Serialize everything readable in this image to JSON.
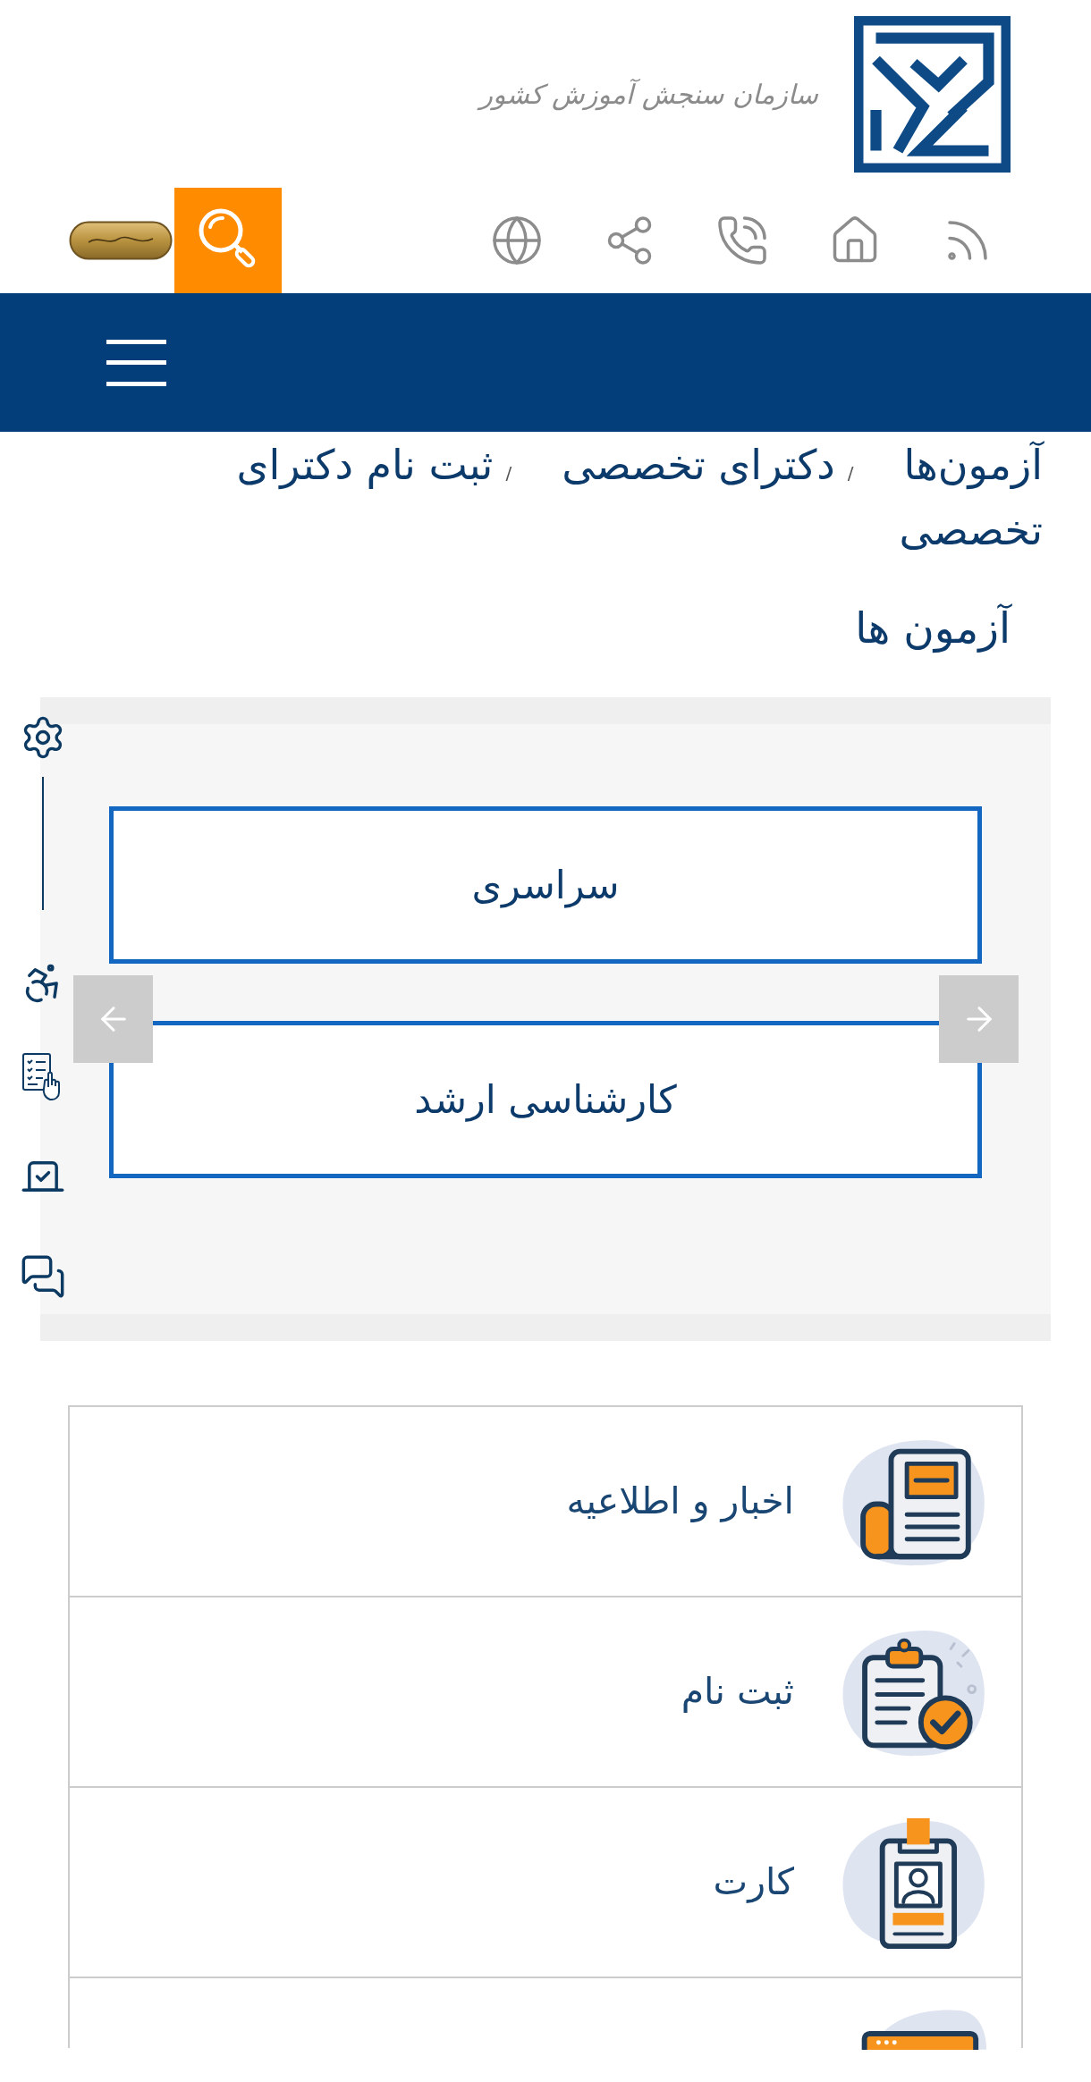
{
  "header": {
    "logo_text": "سازمان سنجش آموزش کشور"
  },
  "breadcrumb": [
    {
      "label": "آزمون‌ها"
    },
    {
      "separator": "/",
      "label": "دکترای تخصصی"
    },
    {
      "separator": "/",
      "label": "ثبت نام دکترای تخصصی"
    }
  ],
  "page_title": "آزمون ها",
  "slider": {
    "slides": [
      {
        "label": "سراسری"
      },
      {
        "label": "کارشناسی ارشد"
      }
    ]
  },
  "menu": [
    {
      "kind": "news",
      "label": "اخبار و اطلاعیه"
    },
    {
      "kind": "registration",
      "label": "ثبت نام"
    },
    {
      "kind": "card",
      "label": "کارت"
    },
    {
      "kind": "window"
    }
  ]
}
